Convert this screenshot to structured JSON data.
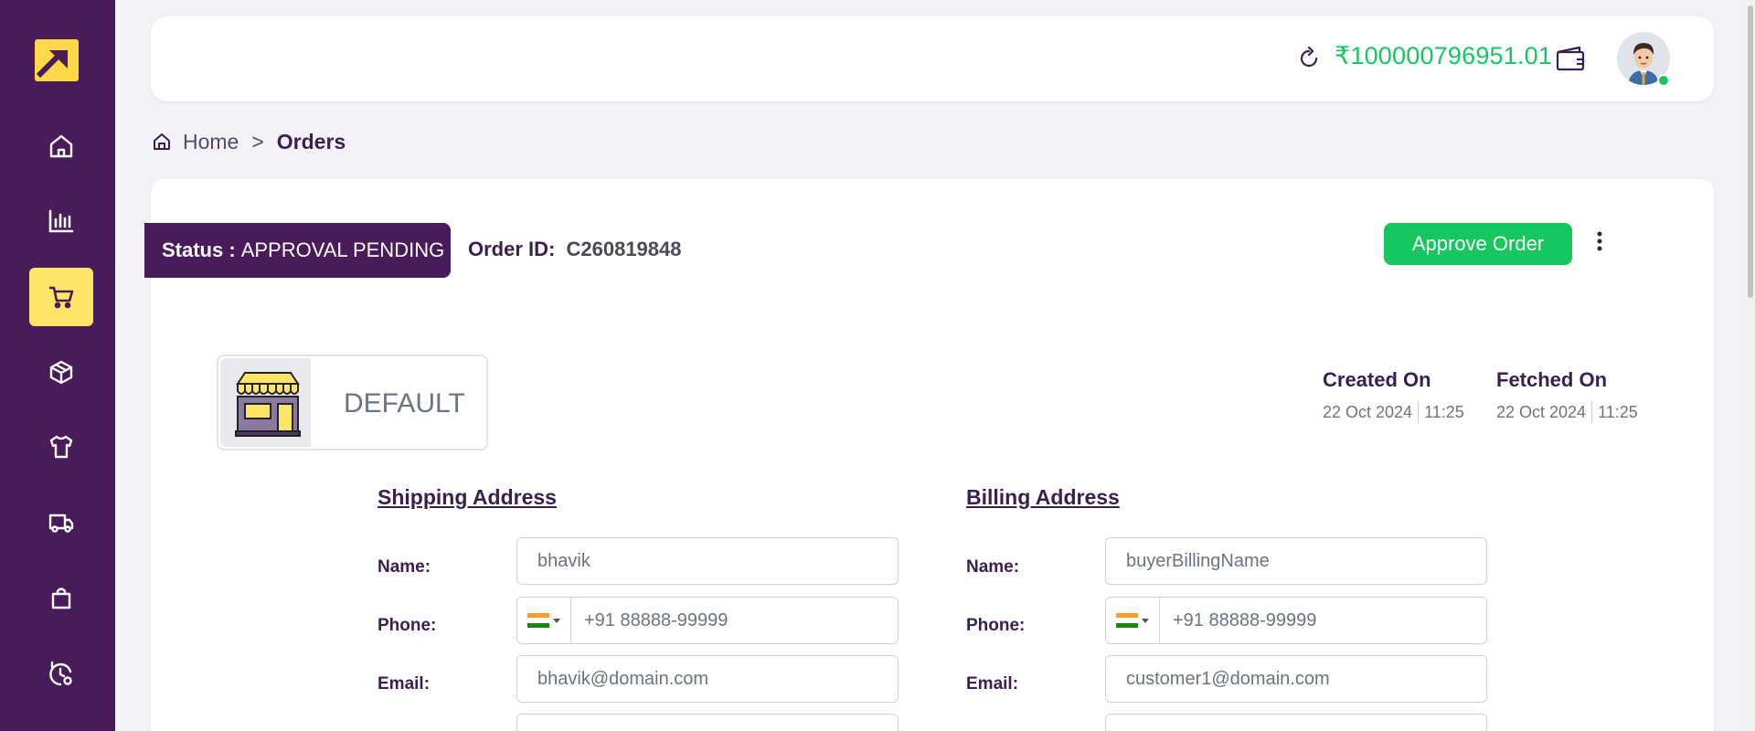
{
  "sidebar": {
    "logo": "arrow-logo-icon",
    "items": [
      {
        "icon": "home-icon",
        "active": false
      },
      {
        "icon": "bar-chart-icon",
        "active": false
      },
      {
        "icon": "cart-icon",
        "active": true
      },
      {
        "icon": "box-icon",
        "active": false
      },
      {
        "icon": "tshirt-icon",
        "active": false
      },
      {
        "icon": "truck-icon",
        "active": false
      },
      {
        "icon": "bag-icon",
        "active": false
      },
      {
        "icon": "settings-history-icon",
        "active": false
      }
    ],
    "colors": {
      "background": "#4a1b5a",
      "active": "#ffe566"
    }
  },
  "topbar": {
    "balance": "₹100000796951.01",
    "balance_color": "#16c65f"
  },
  "breadcrumb": {
    "home": "Home",
    "separator": ">",
    "current": "Orders"
  },
  "order": {
    "status_label": "Status :",
    "status_value": "APPROVAL PENDING",
    "order_id_label": "Order ID:",
    "order_id_value": "C260819848",
    "approve_label": "Approve Order",
    "store_name": "DEFAULT",
    "created_label": "Created On",
    "created_date": "22 Oct 2024",
    "created_time": "11:25",
    "fetched_label": "Fetched On",
    "fetched_date": "22 Oct 2024",
    "fetched_time": "11:25"
  },
  "shipping": {
    "title": "Shipping Address",
    "name_label": "Name:",
    "name_value": "bhavik",
    "phone_label": "Phone:",
    "phone_value": "+91 88888-99999",
    "email_label": "Email:",
    "email_value": "bhavik@domain.com"
  },
  "billing": {
    "title": "Billing Address",
    "name_label": "Name:",
    "name_value": "buyerBillingName",
    "phone_label": "Phone:",
    "phone_value": "+91 88888-99999",
    "email_label": "Email:",
    "email_value": "customer1@domain.com"
  },
  "colors": {
    "accent": "#16c65f",
    "primary": "#4a1b5a",
    "page_bg": "#f3f2f7"
  }
}
